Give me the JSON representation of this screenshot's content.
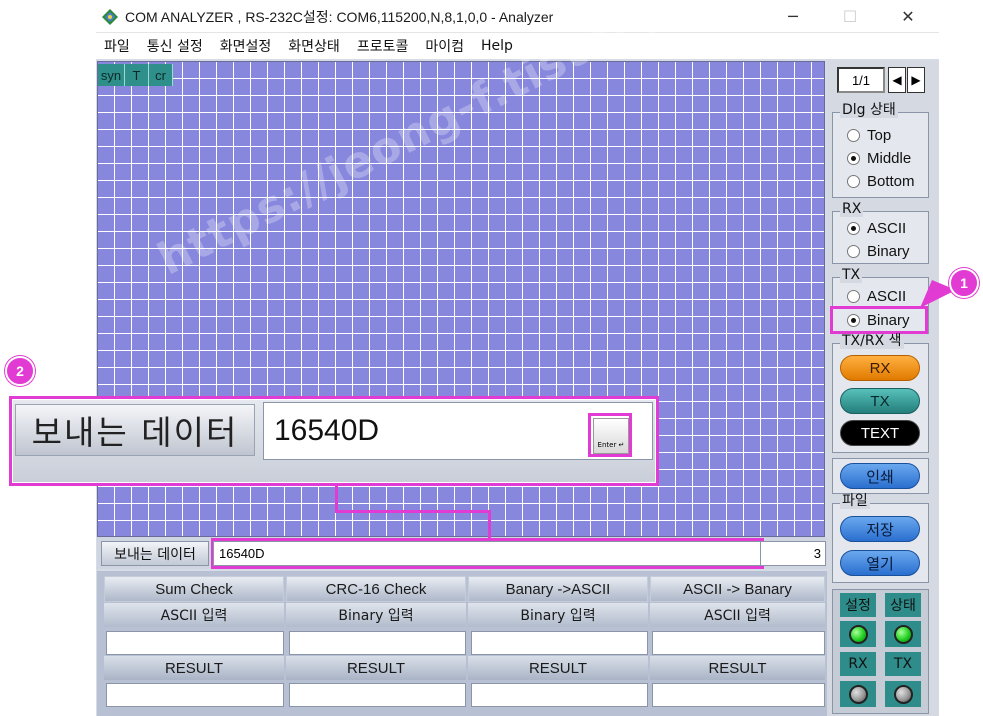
{
  "window": {
    "title": "COM ANALYZER , RS-232C설정: COM6,115200,N,8,1,0,0  - Analyzer",
    "minimize": "─",
    "maximize": "☐",
    "close": "✕"
  },
  "menu": [
    "파일",
    "통신 설정",
    "화면설정",
    "화면상태",
    "프로토콜",
    "마이컴",
    "Help"
  ],
  "grid_tags": [
    "syn",
    "T",
    "cr"
  ],
  "watermark": "https://jeong-f.tistory.com",
  "send": {
    "label": "보내는 데이터",
    "value": "16540D",
    "count": "3"
  },
  "tools": [
    {
      "title": "Sum Check",
      "input_label": "ASCII 입력",
      "result": "RESULT"
    },
    {
      "title": "CRC-16 Check",
      "input_label": "Binary 입력",
      "result": "RESULT"
    },
    {
      "title": "Banary ->ASCII",
      "input_label": "Binary 입력",
      "result": "RESULT"
    },
    {
      "title": "ASCII -> Banary",
      "input_label": "ASCII 입력",
      "result": "RESULT"
    }
  ],
  "right_panel": {
    "page": "1/1",
    "prev": "◀",
    "next": "▶",
    "dlg": {
      "title": "Dlg 상태",
      "options": [
        "Top",
        "Middle",
        "Bottom"
      ],
      "selected": "Middle"
    },
    "rx": {
      "title": "RX",
      "options": [
        "ASCII",
        "Binary"
      ],
      "selected": "ASCII"
    },
    "tx": {
      "title": "TX",
      "options": [
        "ASCII",
        "Binary"
      ],
      "selected": "Binary"
    },
    "color": {
      "title": "TX/RX 색",
      "buttons": [
        "RX",
        "TX",
        "TEXT"
      ]
    },
    "print": "인쇄",
    "file": {
      "title": "파일",
      "save": "저장",
      "open": "열기"
    },
    "status": {
      "labels": [
        "설정",
        "상태",
        "RX",
        "TX"
      ]
    }
  },
  "colors": {
    "rx_button": "#f08a0c",
    "tx_button": "#2e9a96",
    "text_button": "#000000",
    "led_on": "#22d022",
    "led_off": "#9a9a9a",
    "annotation": "#e23bd3"
  },
  "callout": {
    "zoom_label": "보내는 데이터",
    "zoom_value": "16540D",
    "enter_key": "Enter ↵",
    "badge1": "1",
    "badge2": "2"
  }
}
